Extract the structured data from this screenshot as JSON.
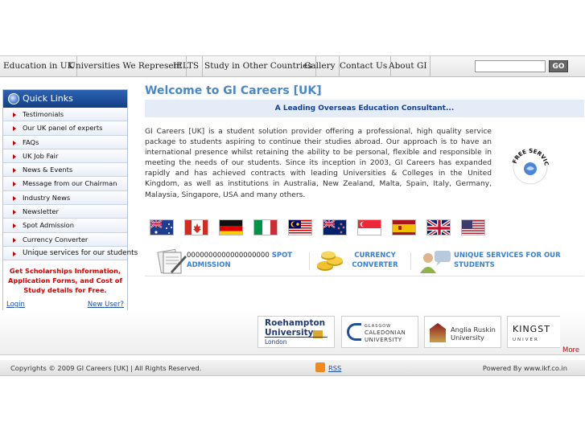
{
  "nav": {
    "items": [
      "Education in UK",
      "Universities We Represent",
      "IELTS",
      "Study in Other Countries",
      "Gallery",
      "Contact Us",
      "About GI"
    ],
    "go_label": "GO"
  },
  "sidebar": {
    "title": "Quick Links",
    "items": [
      "Testimonials",
      "Our UK panel of experts",
      "FAQs",
      "UK Job Fair",
      "News & Events",
      "Message from our Chairman",
      "Industry News",
      "Newsletter",
      "Spot Admission",
      "Currency Converter",
      "Unique services for our students"
    ],
    "promo": "Get Scholarships Information, Application Forms, and Cost of Study details for Free.",
    "login": "Login",
    "new_user": "New User?"
  },
  "main": {
    "welcome": "Welcome to GI Careers [UK]",
    "tagline": "A Leading Overseas Education Consultant...",
    "intro": "GI Careers [UK] is a student solution provider offering a professional, high quality service package to students aspiring to continue their studies abroad. Our approach is to have an international presence whilst retaining the ability to be personal, flexible and responsible in meeting the needs of our students. Since its inception in 2003, GI Careers has expanded rapidly and has achieved contracts with leading Universities & Colleges in the United Kingdom, as well as institutions in Australia, New Zealand, Malta, Spain, Italy, Germany, Malaysia, Singapore, USA and many others.",
    "badge_text": "FREE SERVICES",
    "flags": [
      "australia",
      "canada",
      "germany",
      "italy",
      "malaysia",
      "new-zealand",
      "singapore",
      "spain",
      "united-kingdom",
      "usa"
    ]
  },
  "services": {
    "spot_prefix": "0000000000000000000",
    "spot": "SPOT ADMISSION",
    "currency": "CURRENCY CONVERTER",
    "unique": "UNIQUE SERVICES FOR OUR STUDENTS"
  },
  "universities": {
    "roehampton_1": "Roehampton",
    "roehampton_2": "University",
    "roehampton_3": "London",
    "glasgow_1": "GLASGOW",
    "glasgow_2": "CALEDONIAN",
    "glasgow_3": "UNIVERSITY",
    "anglia_1": "Anglia Ruskin",
    "anglia_2": "University",
    "kingston_1": "KINGST",
    "kingston_2": "UNIVER",
    "more": "More"
  },
  "footer": {
    "copyright": "Copyrights © 2009 GI Careers [UK] | All Rights Reserved.",
    "rss": "RSS",
    "powered": "Powered By www.ikf.co.in"
  },
  "colors": {
    "accent": "#4a86c8",
    "quicklinks": "#1a4a9a",
    "promo_red": "#d40000",
    "service_blue": "#3b7fd0"
  }
}
